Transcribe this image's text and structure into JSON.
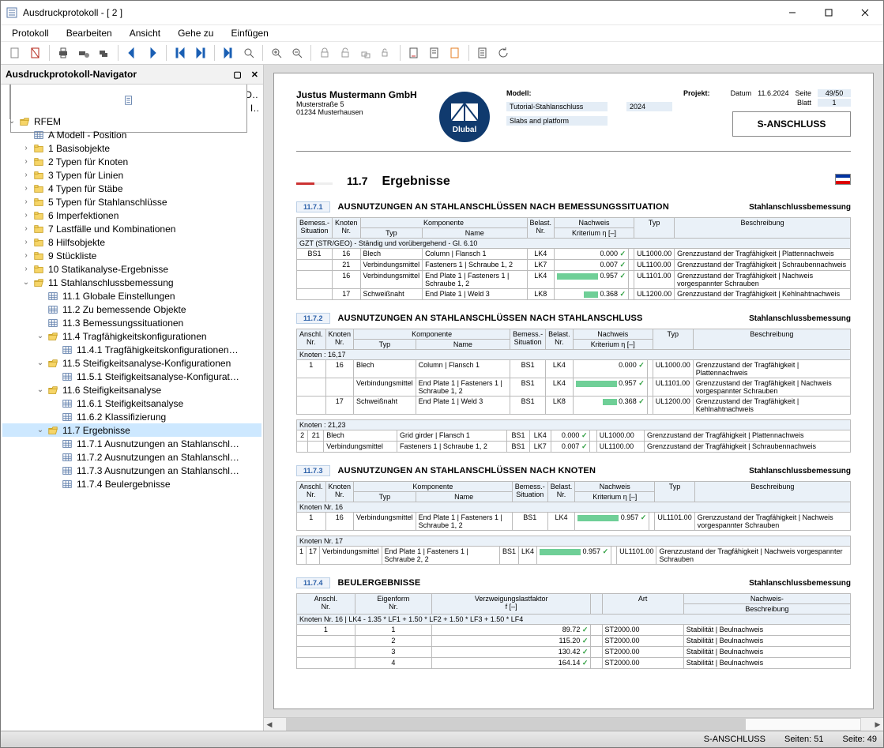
{
  "window": {
    "title": "Ausdruckprotokoll - [ 2 ]"
  },
  "menu": [
    "Protokoll",
    "Bearbeiten",
    "Ansicht",
    "Gehe zu",
    "Einfügen"
  ],
  "nav": {
    "title": "Ausdruckprotokoll-Navigator",
    "items": [
      {
        "depth": 0,
        "tw": "",
        "icon": "page",
        "label": "Deckblatt"
      },
      {
        "depth": 0,
        "tw": "",
        "icon": "page",
        "label": "Inhalt"
      },
      {
        "depth": 0,
        "tw": "v",
        "icon": "fopen",
        "label": "RFEM"
      },
      {
        "depth": 1,
        "tw": "",
        "icon": "grid",
        "label": "A Modell - Position"
      },
      {
        "depth": 1,
        "tw": ">",
        "icon": "folder",
        "label": "1 Basisobjekte"
      },
      {
        "depth": 1,
        "tw": ">",
        "icon": "folder",
        "label": "2 Typen für Knoten"
      },
      {
        "depth": 1,
        "tw": ">",
        "icon": "folder",
        "label": "3 Typen für Linien"
      },
      {
        "depth": 1,
        "tw": ">",
        "icon": "folder",
        "label": "4 Typen für Stäbe"
      },
      {
        "depth": 1,
        "tw": ">",
        "icon": "folder",
        "label": "5 Typen für Stahlanschlüsse"
      },
      {
        "depth": 1,
        "tw": ">",
        "icon": "folder",
        "label": "6 Imperfektionen"
      },
      {
        "depth": 1,
        "tw": ">",
        "icon": "folder",
        "label": "7 Lastfälle und Kombinationen"
      },
      {
        "depth": 1,
        "tw": ">",
        "icon": "folder",
        "label": "8 Hilfsobjekte"
      },
      {
        "depth": 1,
        "tw": ">",
        "icon": "folder",
        "label": "9 Stückliste"
      },
      {
        "depth": 1,
        "tw": ">",
        "icon": "folder",
        "label": "10 Statikanalyse-Ergebnisse"
      },
      {
        "depth": 1,
        "tw": "v",
        "icon": "fopen",
        "label": "11 Stahlanschlussbemessung"
      },
      {
        "depth": 2,
        "tw": "",
        "icon": "grid",
        "label": "11.1 Globale Einstellungen"
      },
      {
        "depth": 2,
        "tw": "",
        "icon": "grid",
        "label": "11.2 Zu bemessende Objekte"
      },
      {
        "depth": 2,
        "tw": "",
        "icon": "grid",
        "label": "11.3 Bemessungssituationen"
      },
      {
        "depth": 2,
        "tw": "v",
        "icon": "fopen",
        "label": "11.4 Tragfähigkeitskonfigurationen"
      },
      {
        "depth": 3,
        "tw": "",
        "icon": "grid",
        "label": "11.4.1 Tragfähigkeitskonfigurationen…"
      },
      {
        "depth": 2,
        "tw": "v",
        "icon": "fopen",
        "label": "11.5 Steifigkeitsanalyse-Konfigurationen"
      },
      {
        "depth": 3,
        "tw": "",
        "icon": "grid",
        "label": "11.5.1 Steifigkeitsanalyse-Konfigurat…"
      },
      {
        "depth": 2,
        "tw": "v",
        "icon": "fopen",
        "label": "11.6 Steifigkeitsanalyse"
      },
      {
        "depth": 3,
        "tw": "",
        "icon": "grid",
        "label": "11.6.1 Steifigkeitsanalyse"
      },
      {
        "depth": 3,
        "tw": "",
        "icon": "grid",
        "label": "11.6.2 Klassifizierung"
      },
      {
        "depth": 2,
        "tw": "v",
        "icon": "fopen",
        "label": "11.7 Ergebnisse",
        "sel": true
      },
      {
        "depth": 3,
        "tw": "",
        "icon": "grid",
        "label": "11.7.1 Ausnutzungen an Stahlanschl…"
      },
      {
        "depth": 3,
        "tw": "",
        "icon": "grid",
        "label": "11.7.2 Ausnutzungen an Stahlanschl…"
      },
      {
        "depth": 3,
        "tw": "",
        "icon": "grid",
        "label": "11.7.3 Ausnutzungen an Stahlanschl…"
      },
      {
        "depth": 3,
        "tw": "",
        "icon": "grid",
        "label": "11.7.4 Beulergebnisse"
      }
    ]
  },
  "page": {
    "header": {
      "company": "Justus Mustermann GmbH",
      "street": "Musterstraße 5",
      "city": "01234 Musterhausen",
      "modell_lbl": "Modell:",
      "modell_val": "Tutorial-Stahlanschluss",
      "modell_val2": "Slabs and platform",
      "projekt_lbl": "Projekt:",
      "projekt_val": "2024",
      "datum_lbl": "Datum",
      "datum_val": "11.6.2024",
      "seite_lbl": "Seite",
      "seite_val": "49/50",
      "blatt_lbl": "Blatt",
      "blatt_val": "1",
      "brand": "S-ANSCHLUSS"
    },
    "chapter": {
      "num": "11.7",
      "title": "Ergebnisse"
    },
    "sub_label": "Stahlanschlussbemessung",
    "s1": {
      "num": "11.7.1",
      "title": "AUSNUTZUNGEN AN STAHLANSCHLÜSSEN NACH BEMESSUNGSSITUATION",
      "headers_top": [
        "Bemess.-",
        "Knoten",
        "Komponente",
        "",
        "Belast.",
        "Nachweis",
        "",
        "",
        ""
      ],
      "headers": [
        "Situation",
        "Nr.",
        "Typ",
        "Name",
        "Nr.",
        "Kriterium η [–]",
        "",
        "Typ",
        "Beschreibung"
      ],
      "group": "GZT (STR/GEO) - Ständig und vorübergehend - Gl. 6.10",
      "rows": [
        {
          "sit": "BS1",
          "kn": "16",
          "typ": "Blech",
          "name": "Column | Flansch 1",
          "bl": "LK4",
          "bar": 0,
          "krit": "0.000",
          "chk": "✓",
          "ntyp": "UL1000.00",
          "desc": "Grenzzustand der Tragfähigkeit | Plattennachweis"
        },
        {
          "sit": "",
          "kn": "21",
          "typ": "Verbindungsmittel",
          "name": "Fasteners 1 | Schraube 1, 2",
          "bl": "LK7",
          "bar": 0,
          "krit": "0.007",
          "chk": "✓",
          "ntyp": "UL1100.00",
          "desc": "Grenzzustand der Tragfähigkeit | Schraubennachweis"
        },
        {
          "sit": "",
          "kn": "16",
          "typ": "Verbindungsmittel",
          "name": "End Plate 1 | Fasteners 1 | Schraube 1, 2",
          "bl": "LK4",
          "bar": 52,
          "krit": "0.957",
          "chk": "✓",
          "ntyp": "UL1101.00",
          "desc": "Grenzzustand der Tragfähigkeit | Nachweis vorgespannter Schrauben"
        },
        {
          "sit": "",
          "kn": "17",
          "typ": "Schweißnaht",
          "name": "End Plate 1 | Weld 3",
          "bl": "LK8",
          "bar": 18,
          "krit": "0.368",
          "chk": "✓",
          "ntyp": "UL1200.00",
          "desc": "Grenzzustand der Tragfähigkeit | Kehlnahtnachweis"
        }
      ]
    },
    "s2": {
      "num": "11.7.2",
      "title": "AUSNUTZUNGEN AN STAHLANSCHLÜSSEN NACH STAHLANSCHLUSS",
      "headers_top": [
        "Anschl.",
        "Knoten",
        "Komponente",
        "",
        "Bemess.-",
        "Belast.",
        "Nachweis",
        "",
        "",
        ""
      ],
      "headers": [
        "Nr.",
        "Nr.",
        "Typ",
        "Name",
        "Situation",
        "Nr.",
        "Kriterium η [–]",
        "",
        "Typ",
        "Beschreibung"
      ],
      "group1": "Knoten : 16,17",
      "rows1": [
        {
          "an": "1",
          "kn": "16",
          "typ": "Blech",
          "name": "Column | Flansch 1",
          "sit": "BS1",
          "bl": "LK4",
          "bar": 0,
          "krit": "0.000",
          "chk": "✓",
          "ntyp": "UL1000.00",
          "desc": "Grenzzustand der Tragfähigkeit | Plattennachweis"
        },
        {
          "an": "",
          "kn": "",
          "typ": "Verbindungsmittel",
          "name": "End Plate 1 | Fasteners 1 | Schraube 1, 2",
          "sit": "BS1",
          "bl": "LK4",
          "bar": 52,
          "krit": "0.957",
          "chk": "✓",
          "ntyp": "UL1101.00",
          "desc": "Grenzzustand der Tragfähigkeit | Nachweis vorgespannter Schrauben"
        },
        {
          "an": "",
          "kn": "17",
          "typ": "Schweißnaht",
          "name": "End Plate 1 | Weld 3",
          "sit": "BS1",
          "bl": "LK8",
          "bar": 18,
          "krit": "0.368",
          "chk": "✓",
          "ntyp": "UL1200.00",
          "desc": "Grenzzustand der Tragfähigkeit | Kehlnahtnachweis"
        }
      ],
      "group2": "Knoten : 21,23",
      "rows2": [
        {
          "an": "2",
          "kn": "21",
          "typ": "Blech",
          "name": "Grid girder | Flansch 1",
          "sit": "BS1",
          "bl": "LK4",
          "bar": 0,
          "krit": "0.000",
          "chk": "✓",
          "ntyp": "UL1000.00",
          "desc": "Grenzzustand der Tragfähigkeit | Plattennachweis"
        },
        {
          "an": "",
          "kn": "",
          "typ": "Verbindungsmittel",
          "name": "Fasteners 1 | Schraube 1, 2",
          "sit": "BS1",
          "bl": "LK7",
          "bar": 0,
          "krit": "0.007",
          "chk": "✓",
          "ntyp": "UL1100.00",
          "desc": "Grenzzustand der Tragfähigkeit | Schraubennachweis"
        }
      ]
    },
    "s3": {
      "num": "11.7.3",
      "title": "AUSNUTZUNGEN AN STAHLANSCHLÜSSEN NACH KNOTEN",
      "headers_top": [
        "Anschl.",
        "Knoten",
        "Komponente",
        "",
        "Bemess.-",
        "Belast.",
        "Nachweis",
        "",
        "",
        ""
      ],
      "headers": [
        "Nr.",
        "Nr.",
        "Typ",
        "Name",
        "Situation",
        "Nr.",
        "Kriterium η [–]",
        "",
        "Typ",
        "Beschreibung"
      ],
      "group1": "Knoten Nr. 16",
      "rows1": [
        {
          "an": "1",
          "kn": "16",
          "typ": "Verbindungsmittel",
          "name": "End Plate 1 | Fasteners 1 | Schraube 1, 2",
          "sit": "BS1",
          "bl": "LK4",
          "bar": 52,
          "krit": "0.957",
          "chk": "✓",
          "ntyp": "UL1101.00",
          "desc": "Grenzzustand der Tragfähigkeit | Nachweis vorgespannter Schrauben"
        }
      ],
      "group2": "Knoten Nr. 17",
      "rows2": [
        {
          "an": "1",
          "kn": "17",
          "typ": "Verbindungsmittel",
          "name": "End Plate 1 | Fasteners 1 | Schraube 2, 2",
          "sit": "BS1",
          "bl": "LK4",
          "bar": 52,
          "krit": "0.957",
          "chk": "✓",
          "ntyp": "UL1101.00",
          "desc": "Grenzzustand der Tragfähigkeit | Nachweis vorgespannter Schrauben"
        }
      ]
    },
    "s4": {
      "num": "11.7.4",
      "title": "BEULERGEBNISSE",
      "headers_top": [
        "Anschl.",
        "Eigenform",
        "Verzweigungslastfaktor",
        "",
        "",
        "Nachweis-"
      ],
      "headers": [
        "Nr.",
        "Nr.",
        "f [–]",
        "",
        "Art",
        "Beschreibung"
      ],
      "group": "Knoten Nr. 16 | LK4 - 1.35 * LF1 + 1.50 * LF2 + 1.50 * LF3 + 1.50 * LF4",
      "rows": [
        {
          "an": "1",
          "ef": "1",
          "f": "89.72",
          "chk": "✓",
          "art": "ST2000.00",
          "desc": "Stabilität | Beulnachweis"
        },
        {
          "an": "",
          "ef": "2",
          "f": "115.20",
          "chk": "✓",
          "art": "ST2000.00",
          "desc": "Stabilität | Beulnachweis"
        },
        {
          "an": "",
          "ef": "3",
          "f": "130.42",
          "chk": "✓",
          "art": "ST2000.00",
          "desc": "Stabilität | Beulnachweis"
        },
        {
          "an": "",
          "ef": "4",
          "f": "164.14",
          "chk": "✓",
          "art": "ST2000.00",
          "desc": "Stabilität | Beulnachweis"
        }
      ]
    }
  },
  "status": {
    "brand": "S-ANSCHLUSS",
    "pages_lbl": "Seiten:",
    "pages": "51",
    "page_lbl": "Seite:",
    "page": "49"
  }
}
